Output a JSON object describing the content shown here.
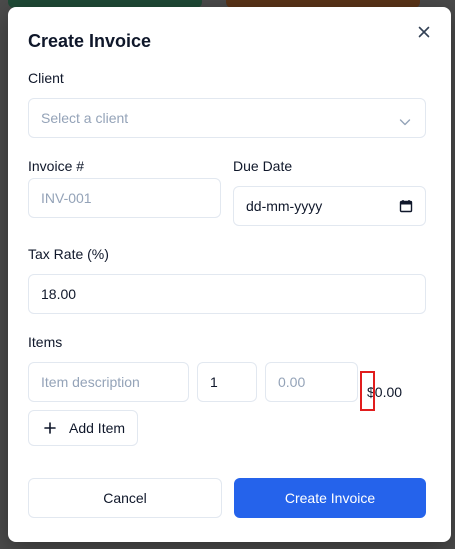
{
  "colors": {
    "primary": "#2563eb",
    "border": "#e2e8f0",
    "placeholder": "#94a3b8",
    "text": "#0f172a",
    "marker": "#e11d1d"
  },
  "modal": {
    "title": "Create Invoice",
    "close_icon": "close-icon"
  },
  "client": {
    "label": "Client",
    "placeholder": "Select a client",
    "icon": "chevron-down-icon"
  },
  "invoice_number": {
    "label": "Invoice #",
    "placeholder": "INV-001"
  },
  "due_date": {
    "label": "Due Date",
    "value": "dd-mm-yyyy",
    "icon": "calendar-icon"
  },
  "tax_rate": {
    "label": "Tax Rate (%)",
    "value": "18.00"
  },
  "items": {
    "label": "Items",
    "rows": [
      {
        "description_placeholder": "Item description",
        "quantity": "1",
        "price_placeholder": "0.00",
        "line_total": "$0.00"
      }
    ],
    "add_label": "Add Item",
    "add_icon": "plus-icon"
  },
  "actions": {
    "cancel_label": "Cancel",
    "submit_label": "Create Invoice"
  }
}
